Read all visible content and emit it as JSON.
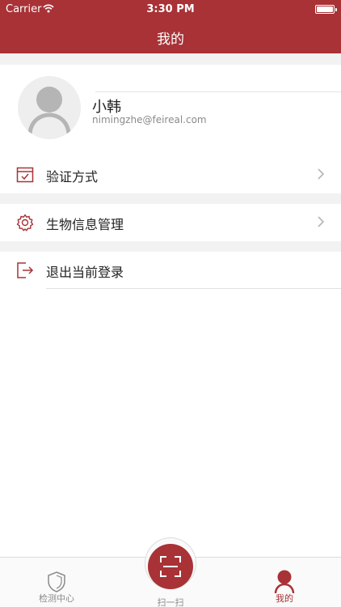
{
  "status_bar": {
    "carrier": "Carrier",
    "time": "3:30 PM"
  },
  "nav": {
    "title": "我的"
  },
  "profile": {
    "name": "小韩",
    "email": "nimingzhe@feireal.com"
  },
  "menu": [
    {
      "label": "验证方式",
      "icon": "verify-method-icon",
      "has_chevron": true
    },
    {
      "label": "生物信息管理",
      "icon": "gear-icon",
      "has_chevron": true
    },
    {
      "label": "退出当前登录",
      "icon": "logout-icon",
      "has_chevron": false
    }
  ],
  "tabs": [
    {
      "label": "检测中心",
      "icon": "shield-icon",
      "active": false
    },
    {
      "label": "扫一扫",
      "icon": "scan-icon",
      "active": false
    },
    {
      "label": "我的",
      "icon": "person-icon",
      "active": true
    }
  ],
  "colors": {
    "accent": "#a83236",
    "background": "#ffffff",
    "band": "#f2f2f2",
    "inactive": "#8a8a8a"
  }
}
